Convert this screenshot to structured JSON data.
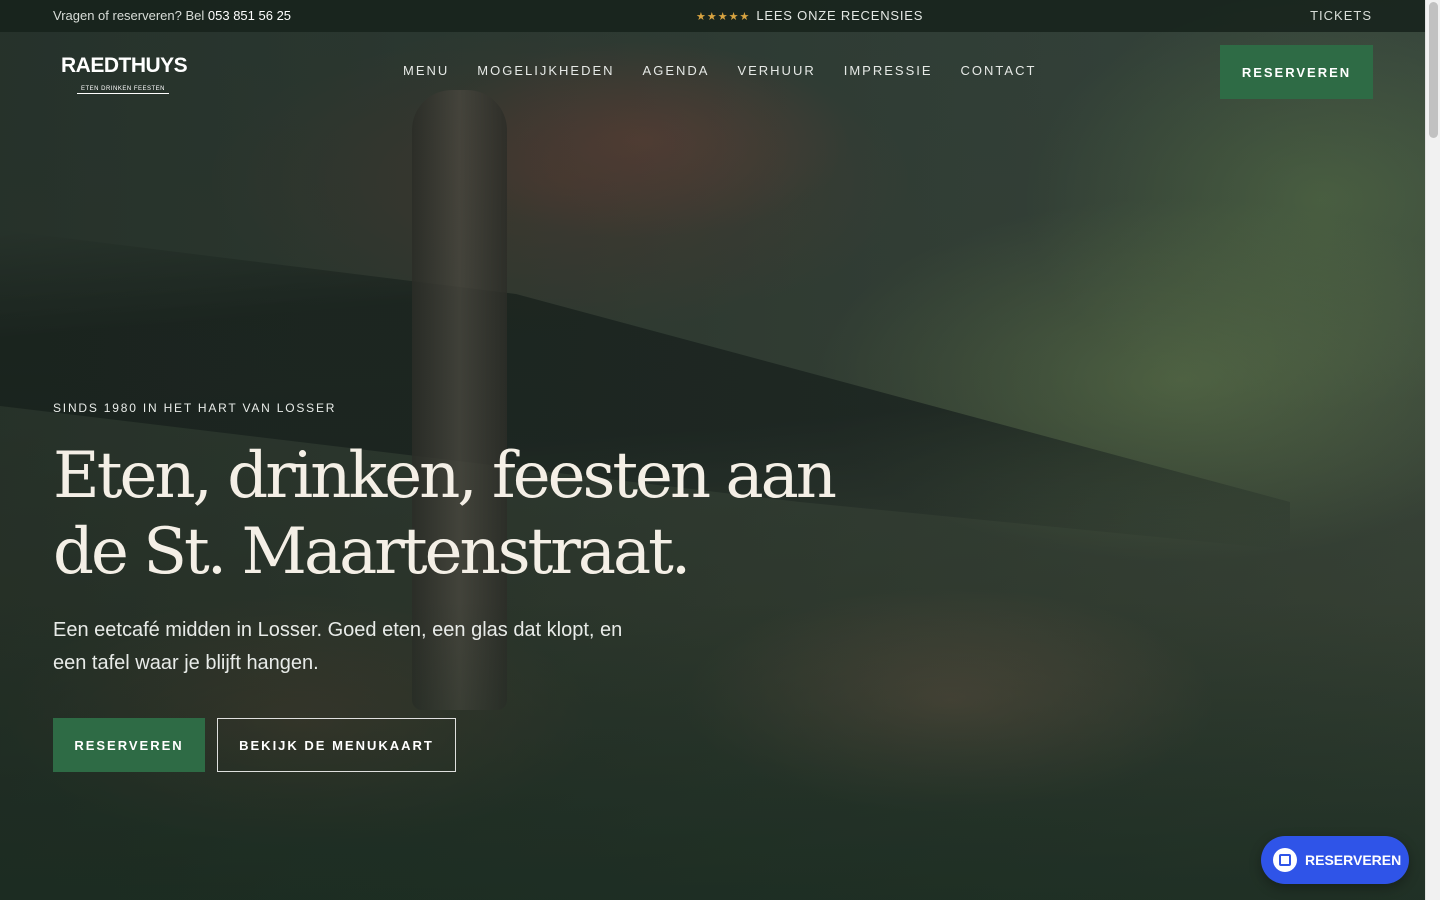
{
  "topbar": {
    "contact_prefix": "Vragen of reserveren? Bel ",
    "phone": "053 851 56 25",
    "stars": "★★★★★",
    "reviews_link": "LEES ONZE RECENSIES",
    "tickets_link": "TICKETS"
  },
  "header": {
    "logo_main": "RAEDTHUYS",
    "logo_sub": "ETEN DRINKEN FEESTEN",
    "nav": [
      "MENU",
      "MOGELIJKHEDEN",
      "AGENDA",
      "VERHUUR",
      "IMPRESSIE",
      "CONTACT"
    ],
    "cta": "RESERVEREN"
  },
  "hero": {
    "eyebrow": "SINDS 1980 IN HET HART VAN LOSSER",
    "headline": "Eten, drinken, feesten aan de St. Maartenstraat.",
    "lead": "Een eetcafé midden in Losser. Goed eten, een glas dat klopt, en een tafel waar je blijft hangen.",
    "primary_button": "RESERVEREN",
    "secondary_button": "BEKIJK DE MENUKAART"
  },
  "widget": {
    "label": "RESERVEREN",
    "color": "#2f54e8"
  },
  "colors": {
    "brand_green": "#2e6b45",
    "accent_star": "#d9a441"
  }
}
